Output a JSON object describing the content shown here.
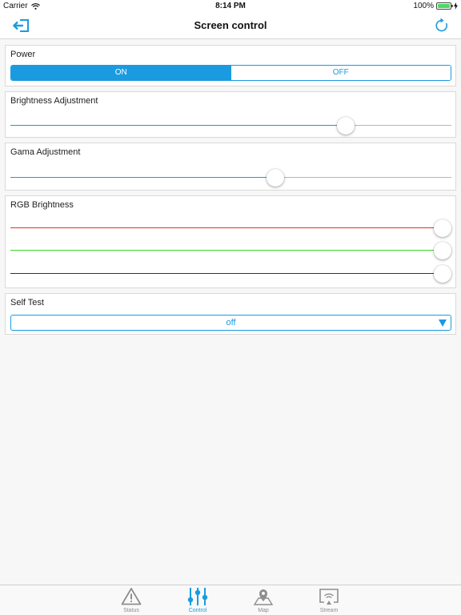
{
  "status_bar": {
    "carrier": "Carrier",
    "time": "8:14 PM",
    "battery": "100%",
    "battery_level": 1.0
  },
  "nav": {
    "title": "Screen control",
    "left_icon": "logout-icon",
    "right_icon": "refresh-icon"
  },
  "power": {
    "title": "Power",
    "on_label": "ON",
    "off_label": "OFF",
    "selected": "ON"
  },
  "brightness": {
    "title": "Brightness Adjustment",
    "value": 0.76
  },
  "gama": {
    "title": "Gama Adjustment",
    "value": 0.6
  },
  "rgb": {
    "title": "RGB Brightness",
    "channels": [
      {
        "name": "red",
        "color": "#e0321c",
        "value": 1.0
      },
      {
        "name": "green",
        "color": "#3fd62a",
        "value": 1.0
      },
      {
        "name": "blue",
        "color": "#1228c8",
        "value": 1.0
      }
    ]
  },
  "self_test": {
    "title": "Self Test",
    "selected": "off"
  },
  "tabs": [
    {
      "label": "Status",
      "icon": "warning-icon",
      "active": false
    },
    {
      "label": "Control",
      "icon": "sliders-icon",
      "active": true
    },
    {
      "label": "Map",
      "icon": "map-pin-icon",
      "active": false
    },
    {
      "label": "Stream",
      "icon": "cast-icon",
      "active": false
    }
  ],
  "colors": {
    "accent": "#1a9be0"
  }
}
